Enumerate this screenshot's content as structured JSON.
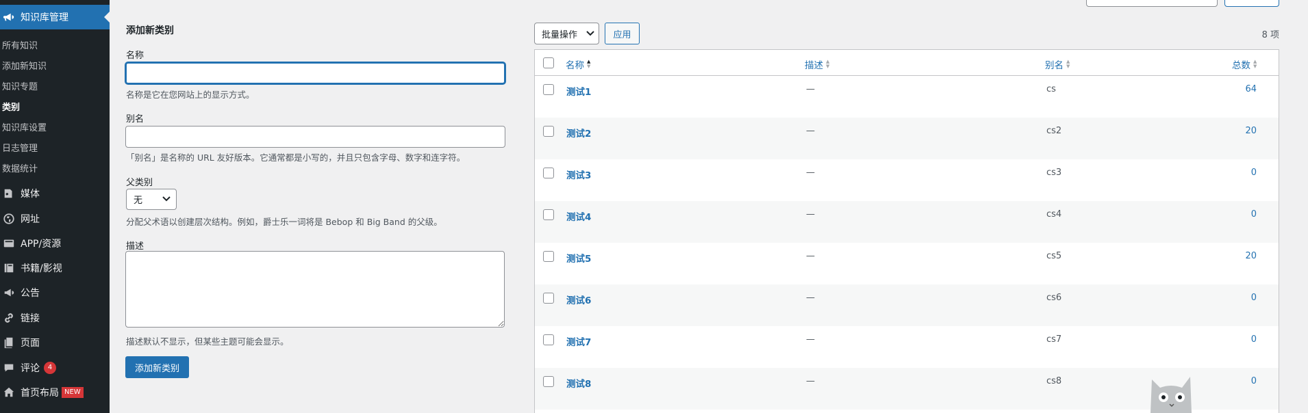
{
  "sidebar": {
    "current_menu": "知识库管理",
    "submenu": [
      "所有知识",
      "添加新知识",
      "知识专题",
      "类别",
      "知识库设置",
      "日志管理",
      "数据统计"
    ],
    "current_submenu": "类别",
    "menu": [
      {
        "label": "媒体",
        "icon": "media-icon"
      },
      {
        "label": "网址",
        "icon": "globe-icon"
      },
      {
        "label": "APP/资源",
        "icon": "app-icon"
      },
      {
        "label": "书籍/影视",
        "icon": "book-icon"
      },
      {
        "label": "公告",
        "icon": "megaphone-icon"
      },
      {
        "label": "链接",
        "icon": "link-icon"
      },
      {
        "label": "页面",
        "icon": "page-icon"
      },
      {
        "label": "评论",
        "icon": "comment-icon",
        "badge": "4"
      },
      {
        "label": "首页布局",
        "icon": "home-icon",
        "tag": "NEW"
      }
    ]
  },
  "form": {
    "heading": "添加新类别",
    "name_label": "名称",
    "name_value": "",
    "name_help": "名称是它在您网站上的显示方式。",
    "slug_label": "别名",
    "slug_value": "",
    "slug_help": "「别名」是名称的 URL 友好版本。它通常都是小写的，并且只包含字母、数字和连字符。",
    "parent_label": "父类别",
    "parent_selected": "无",
    "parent_help": "分配父术语以创建层次结构。例如，爵士乐一词将是 Bebop 和 Big Band 的父级。",
    "desc_label": "描述",
    "desc_value": "",
    "desc_help": "描述默认不显示，但某些主题可能会显示。",
    "submit_label": "添加新类别"
  },
  "table": {
    "bulk_action": "批量操作",
    "apply_label": "应用",
    "item_count": "8 项",
    "columns": {
      "name": "名称",
      "desc": "描述",
      "slug": "别名",
      "count": "总数"
    },
    "rows": [
      {
        "name": "测试1",
        "desc": "—",
        "slug": "cs",
        "count": "64"
      },
      {
        "name": "测试2",
        "desc": "—",
        "slug": "cs2",
        "count": "20"
      },
      {
        "name": "测试3",
        "desc": "—",
        "slug": "cs3",
        "count": "0"
      },
      {
        "name": "测试4",
        "desc": "—",
        "slug": "cs4",
        "count": "0"
      },
      {
        "name": "测试5",
        "desc": "—",
        "slug": "cs5",
        "count": "20"
      },
      {
        "name": "测试6",
        "desc": "—",
        "slug": "cs6",
        "count": "0"
      },
      {
        "name": "测试7",
        "desc": "—",
        "slug": "cs7",
        "count": "0"
      },
      {
        "name": "测试8",
        "desc": "—",
        "slug": "cs8",
        "count": "0"
      }
    ]
  },
  "colors": {
    "accent": "#2271b1",
    "sidebar_bg": "#1d2327",
    "badge": "#d63638"
  }
}
